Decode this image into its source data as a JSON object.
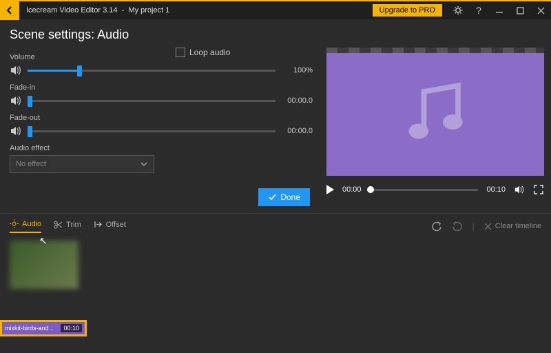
{
  "titlebar": {
    "app": "Icecream Video Editor 3.14",
    "sep": "-",
    "project": "My project 1",
    "upgrade": "Upgrade to PRO"
  },
  "page": {
    "title": "Scene settings: Audio"
  },
  "audio": {
    "volume": {
      "label": "Volume",
      "value": "100%",
      "fillPct": 20
    },
    "fadein": {
      "label": "Fade-in",
      "value": "00:00.0",
      "fillPct": 0
    },
    "fadeout": {
      "label": "Fade-out",
      "value": "00:00.0",
      "fillPct": 0
    },
    "loop": {
      "label": "Loop audio",
      "checked": false
    },
    "effect": {
      "label": "Audio effect",
      "selected": "No effect"
    },
    "done": "Done"
  },
  "preview": {
    "current": "00:00",
    "total": "00:10"
  },
  "tabs": {
    "audio": "Audio",
    "trim": "Trim",
    "offset": "Offset",
    "clear": "Clear timeline"
  },
  "clip": {
    "name": "mixkit-birds-and...",
    "duration": "00:10"
  }
}
